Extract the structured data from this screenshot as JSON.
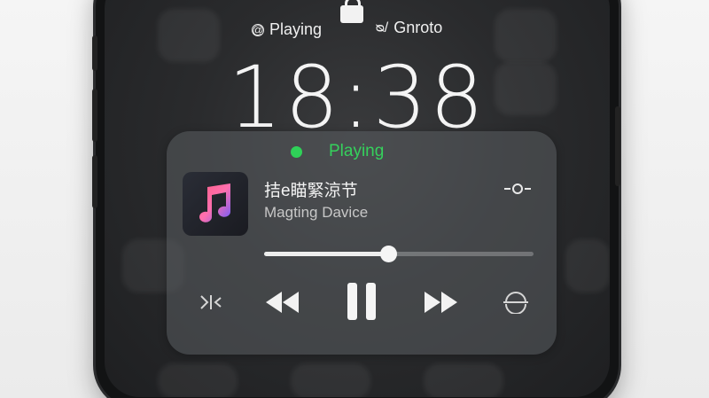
{
  "status_bar": {
    "left_icon": "at-icon",
    "left_label": "Playing",
    "right_icon": "signal-icon",
    "right_label": "Gnroto"
  },
  "lock_screen": {
    "time": "18:38",
    "playing_status": "Playing",
    "status_dot_color": "#2fd158"
  },
  "now_playing": {
    "track_title": "拮e瞄緊涼节",
    "device": "Magting Davice",
    "progress": 0.46,
    "album_icon": "music-note-icon",
    "controls": [
      "shuffle-icon",
      "rewind-icon",
      "pause-icon",
      "fast-forward-icon",
      "repeat-icon"
    ],
    "accent_colors": {
      "note_gradient_start": "#ff6b8a",
      "note_gradient_end": "#6a5cff"
    }
  }
}
